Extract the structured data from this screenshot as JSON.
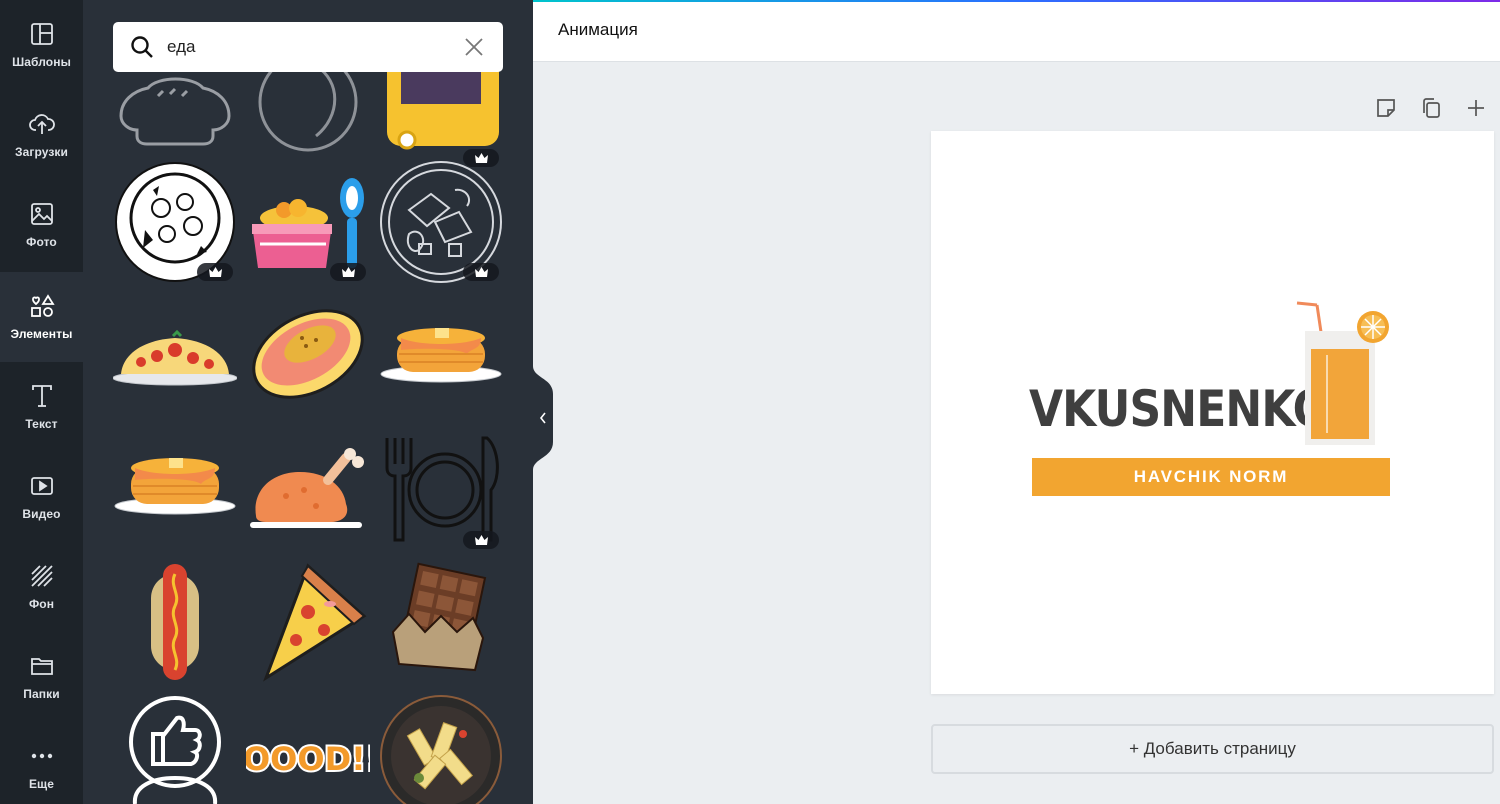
{
  "sidebar": {
    "items": [
      {
        "label": "Шаблоны",
        "icon": "layout-icon"
      },
      {
        "label": "Загрузки",
        "icon": "cloud-upload-icon"
      },
      {
        "label": "Фото",
        "icon": "image-icon"
      },
      {
        "label": "Элементы",
        "icon": "shapes-icon"
      },
      {
        "label": "Текст",
        "icon": "text-icon"
      },
      {
        "label": "Видео",
        "icon": "video-icon"
      },
      {
        "label": "Фон",
        "icon": "background-icon"
      },
      {
        "label": "Папки",
        "icon": "folder-icon"
      },
      {
        "label": "Еще",
        "icon": "more-icon"
      }
    ],
    "active": "Элементы"
  },
  "search": {
    "value": "еда",
    "icon": "search-icon",
    "clear_icon": "close-icon"
  },
  "elements": {
    "items": [
      {
        "name": "pie",
        "premium": false
      },
      {
        "name": "plate-outline",
        "premium": false
      },
      {
        "name": "yellow-device",
        "premium": true
      },
      {
        "name": "pizza-plate",
        "premium": true
      },
      {
        "name": "pink-bowl-spoon",
        "premium": true
      },
      {
        "name": "salad-plate",
        "premium": true
      },
      {
        "name": "spaghetti",
        "premium": false
      },
      {
        "name": "papaya",
        "premium": false
      },
      {
        "name": "pancakes",
        "premium": false
      },
      {
        "name": "pancakes-2",
        "premium": false
      },
      {
        "name": "roast-chicken",
        "premium": false
      },
      {
        "name": "fork-plate-knife",
        "premium": true
      },
      {
        "name": "hotdog",
        "premium": false
      },
      {
        "name": "pizza-slice",
        "premium": false
      },
      {
        "name": "chocolate",
        "premium": false
      },
      {
        "name": "thumbs-up-food",
        "premium": true
      },
      {
        "name": "foood-sticker",
        "premium": false,
        "text": "FOOOD!!!"
      },
      {
        "name": "pasta-plate",
        "premium": false
      }
    ]
  },
  "topbar": {
    "animation_label": "Анимация"
  },
  "page_tools": [
    "note-icon",
    "duplicate-icon",
    "plus-icon"
  ],
  "design": {
    "brand": "VKUSNENKO",
    "tagline": "HAVCHIK NORM",
    "accent": "#f2a530",
    "brand_color": "#3f3f3f"
  },
  "add_page_label": "+ Добавить страницу",
  "colors": {
    "rail": "#0e1318",
    "panel": "#293039",
    "canvas_bg": "#ebeef1"
  }
}
